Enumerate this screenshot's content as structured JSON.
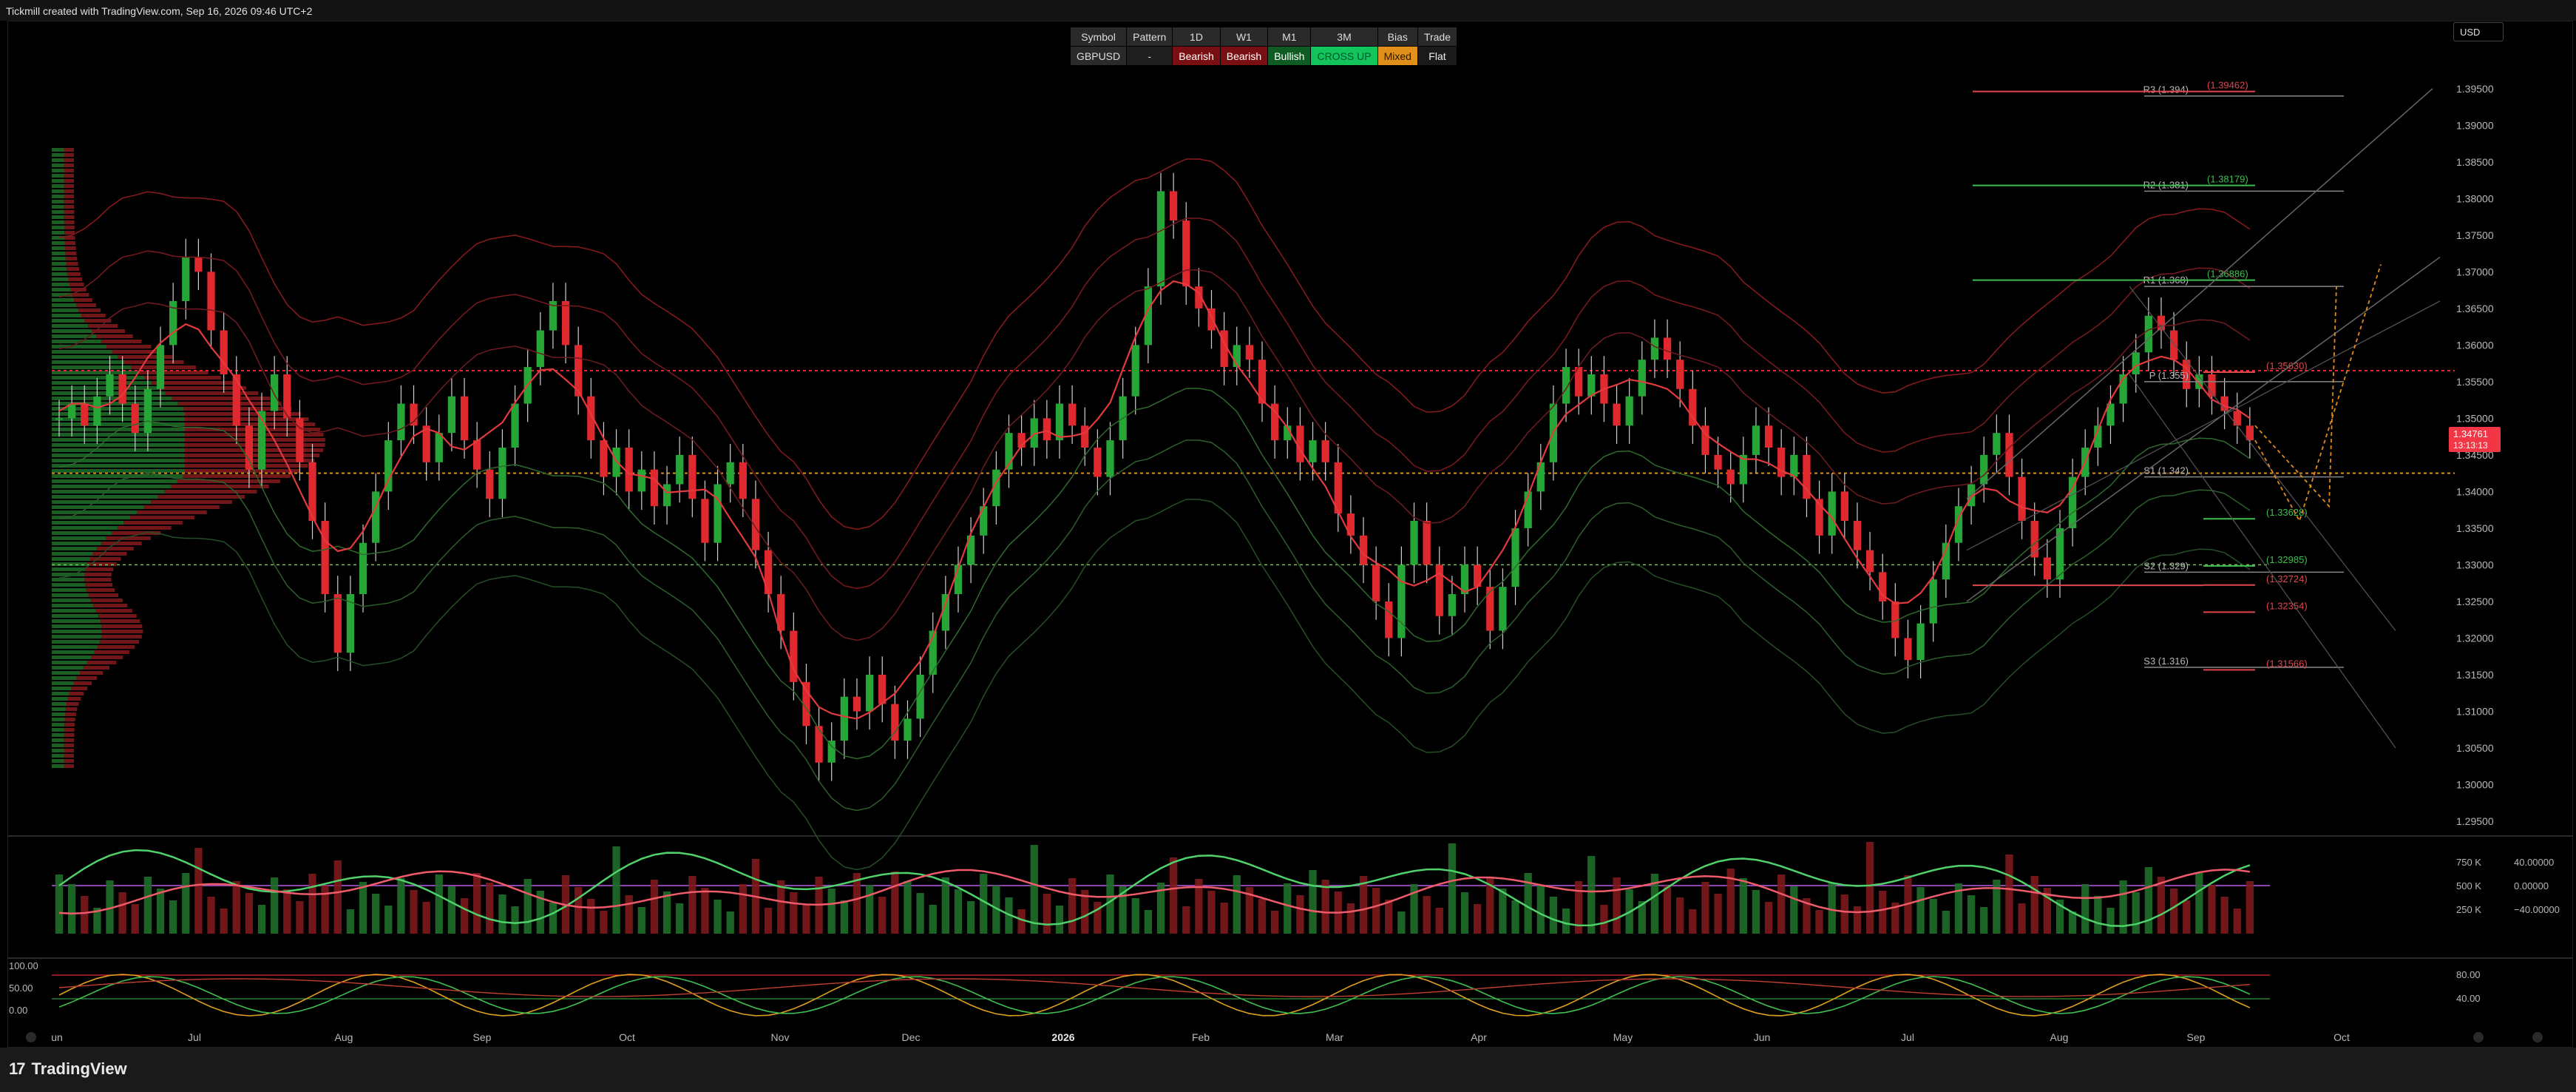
{
  "header": {
    "text": "Tickmill created with TradingView.com, Sep 16, 2026 09:46 UTC+2"
  },
  "currency": "USD",
  "signal_table": {
    "headers": [
      "Symbol",
      "Pattern",
      "1D",
      "W1",
      "M1",
      "3M",
      "Bias",
      "Trade"
    ],
    "row": [
      "GBPUSD",
      "-",
      "Bearish",
      "Bearish",
      "Bullish",
      "CROSS UP",
      "Mixed",
      "Flat"
    ]
  },
  "price_axis": {
    "ticks": [
      "1.39500",
      "1.39000",
      "1.38500",
      "1.38000",
      "1.37500",
      "1.37000",
      "1.36500",
      "1.36000",
      "1.35500",
      "1.35000",
      "1.34500",
      "1.34000",
      "1.33500",
      "1.33000",
      "1.32500",
      "1.32000",
      "1.31500",
      "1.31000",
      "1.30500",
      "1.30000",
      "1.29500"
    ],
    "current_price": "1.34761",
    "countdown": "13:13:13"
  },
  "pivot_levels": [
    {
      "label": "R3 (1.394)",
      "price": 1.394
    },
    {
      "label": "R2 (1.381)",
      "price": 1.381
    },
    {
      "label": "R1 (1.368)",
      "price": 1.368
    },
    {
      "label": "P (1.355)",
      "price": 1.355
    },
    {
      "label": "S1 (1.342)",
      "price": 1.342
    },
    {
      "label": "S2 (1.329)",
      "price": 1.329
    },
    {
      "label": "S3 (1.316)",
      "price": 1.316
    }
  ],
  "level_labels": [
    {
      "text": "(1.39462)",
      "price": 1.39462,
      "color": "#e0474c"
    },
    {
      "text": "(1.38179)",
      "price": 1.38179,
      "color": "#3fbf4f"
    },
    {
      "text": "(1.36886)",
      "price": 1.36886,
      "color": "#3fbf4f"
    },
    {
      "text": "(1.35630)",
      "price": 1.3563,
      "color": "#e0474c"
    },
    {
      "text": "(1.33628)",
      "price": 1.33628,
      "color": "#3fbf4f"
    },
    {
      "text": "(1.32985)",
      "price": 1.32985,
      "color": "#3fbf4f"
    },
    {
      "text": "(1.32724)",
      "price": 1.32724,
      "color": "#e0474c"
    },
    {
      "text": "(1.32354)",
      "price": 1.32354,
      "color": "#e0474c"
    },
    {
      "text": "(1.31566)",
      "price": 1.31566,
      "color": "#e0474c"
    }
  ],
  "volume_axis": [
    "750 K",
    "500 K",
    "250 K"
  ],
  "oscillator_axis": [
    "40.00000",
    "0.00000",
    "−40.00000"
  ],
  "stoch_left_axis": [
    "100.00",
    "50.00",
    "0.00"
  ],
  "stoch_right_axis": [
    "80.00",
    "40.00"
  ],
  "time_axis": [
    "un",
    "Jul",
    "Aug",
    "Sep",
    "Oct",
    "Nov",
    "Dec",
    "2026",
    "Feb",
    "Mar",
    "Apr",
    "May",
    "Jun",
    "Jul",
    "Aug",
    "Sep",
    "Oct"
  ],
  "footer": {
    "logo": "TradingView"
  },
  "colors": {
    "bull": "#26a637",
    "bear": "#e0292f",
    "accent": "#f7525f"
  },
  "chart_data": {
    "type": "candlestick",
    "symbol": "GBPUSD",
    "ylim": [
      1.295,
      1.397
    ],
    "close_path": [
      1.35,
      1.352,
      1.349,
      1.353,
      1.356,
      1.352,
      1.348,
      1.354,
      1.36,
      1.366,
      1.372,
      1.37,
      1.362,
      1.356,
      1.349,
      1.343,
      1.351,
      1.356,
      1.35,
      1.344,
      1.336,
      1.326,
      1.318,
      1.326,
      1.333,
      1.34,
      1.347,
      1.352,
      1.349,
      1.344,
      1.348,
      1.353,
      1.347,
      1.343,
      1.339,
      1.346,
      1.352,
      1.357,
      1.362,
      1.366,
      1.36,
      1.353,
      1.347,
      1.342,
      1.346,
      1.34,
      1.343,
      1.338,
      1.341,
      1.345,
      1.339,
      1.333,
      1.341,
      1.344,
      1.339,
      1.332,
      1.326,
      1.321,
      1.314,
      1.308,
      1.303,
      1.306,
      1.312,
      1.31,
      1.315,
      1.311,
      1.306,
      1.309,
      1.315,
      1.321,
      1.326,
      1.33,
      1.334,
      1.338,
      1.343,
      1.348,
      1.346,
      1.35,
      1.347,
      1.352,
      1.349,
      1.346,
      1.342,
      1.347,
      1.353,
      1.36,
      1.368,
      1.381,
      1.377,
      1.368,
      1.365,
      1.362,
      1.357,
      1.36,
      1.358,
      1.352,
      1.347,
      1.349,
      1.344,
      1.347,
      1.344,
      1.337,
      1.334,
      1.33,
      1.325,
      1.32,
      1.33,
      1.336,
      1.33,
      1.323,
      1.326,
      1.33,
      1.327,
      1.321,
      1.327,
      1.335,
      1.34,
      1.344,
      1.352,
      1.357,
      1.353,
      1.356,
      1.352,
      1.349,
      1.353,
      1.358,
      1.361,
      1.358,
      1.354,
      1.349,
      1.345,
      1.343,
      1.341,
      1.345,
      1.349,
      1.346,
      1.342,
      1.345,
      1.339,
      1.334,
      1.34,
      1.336,
      1.332,
      1.329,
      1.325,
      1.32,
      1.317,
      1.322,
      1.328,
      1.333,
      1.338,
      1.341,
      1.345,
      1.348,
      1.342,
      1.336,
      1.331,
      1.328,
      1.335,
      1.342,
      1.346,
      1.349,
      1.352,
      1.356,
      1.359,
      1.364,
      1.362,
      1.358,
      1.354,
      1.356,
      1.353,
      1.351,
      1.349,
      1.347
    ]
  }
}
